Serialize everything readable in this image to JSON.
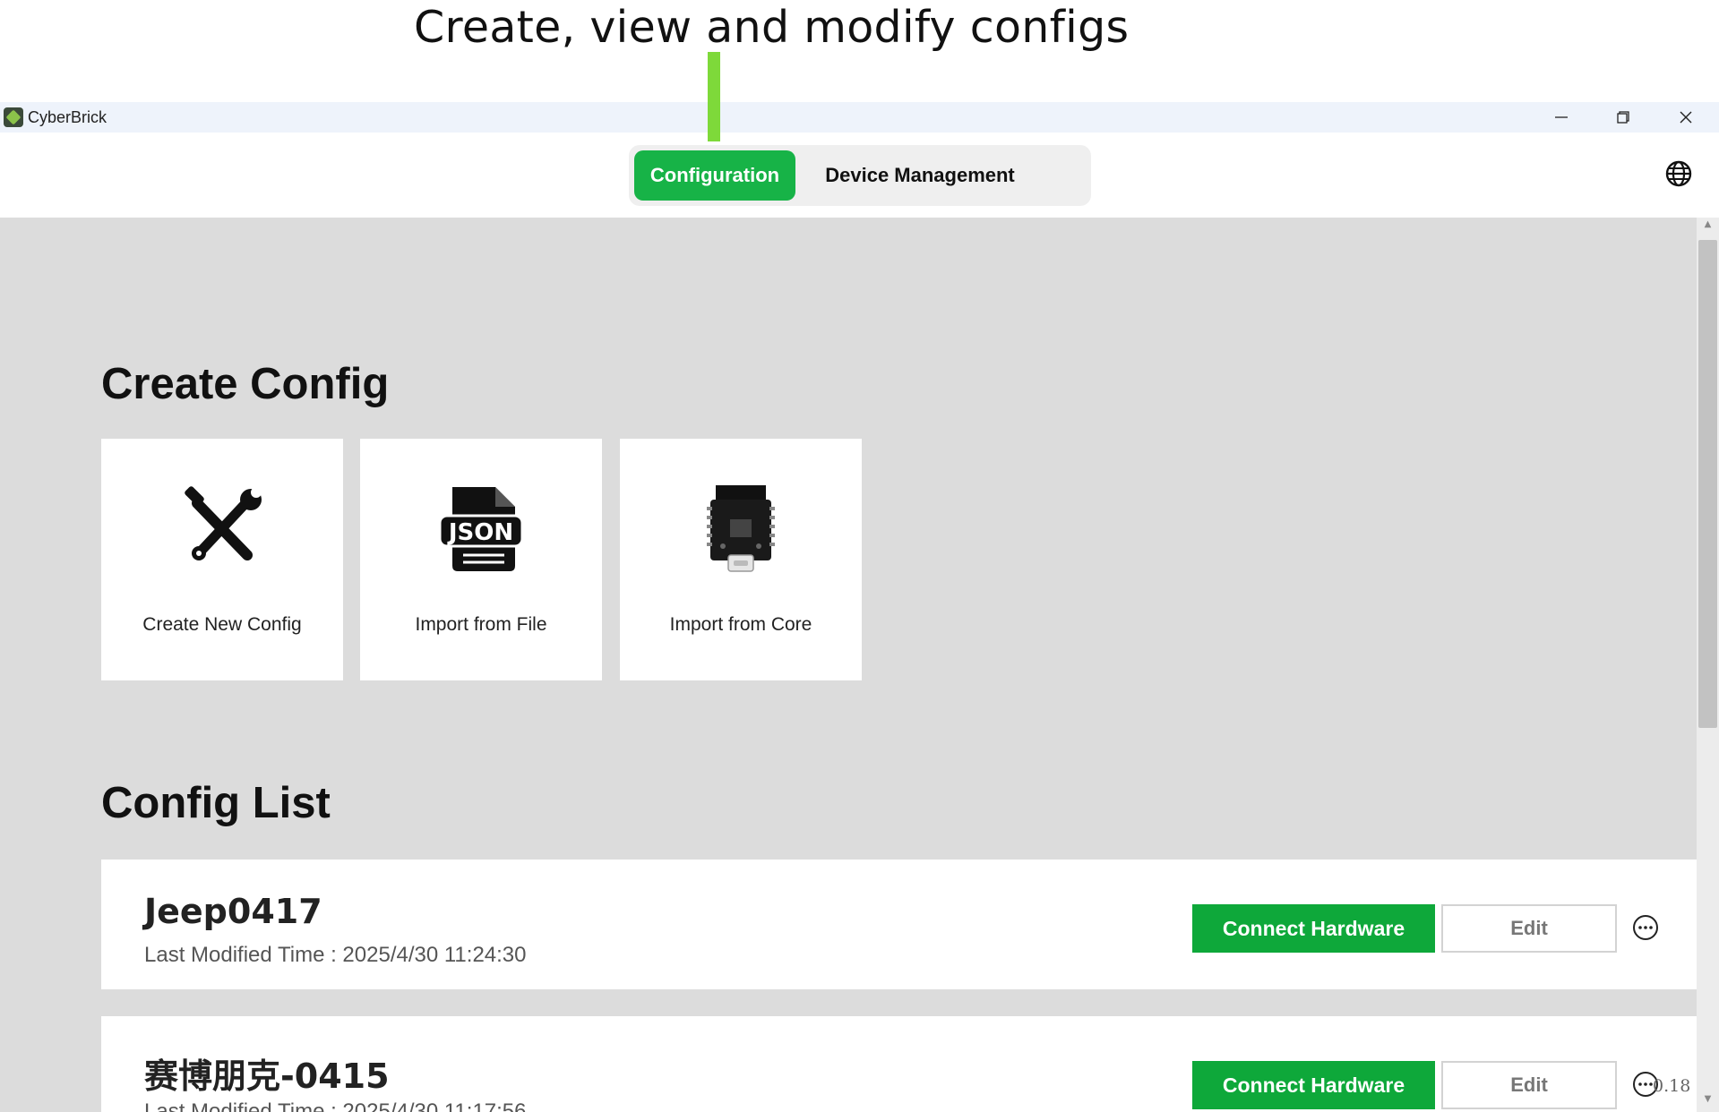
{
  "annotation": {
    "text": "Create, view and modify configs"
  },
  "window": {
    "title": "CyberBrick",
    "logo_icon": "cyberbrick-logo-icon",
    "controls": [
      "minimize-icon",
      "restore-icon",
      "close-icon"
    ]
  },
  "tabs": [
    {
      "label": "Configuration",
      "active": true
    },
    {
      "label": "Device Management",
      "active": false
    }
  ],
  "header": {
    "language_icon": "globe-icon"
  },
  "create_section": {
    "title": "Create Config",
    "cards": [
      {
        "label": "Create New Config",
        "icon": "tools-icon"
      },
      {
        "label": "Import from File",
        "icon": "json-file-icon"
      },
      {
        "label": "Import from Core",
        "icon": "core-board-icon"
      }
    ]
  },
  "list_section": {
    "title": "Config List",
    "items": [
      {
        "name": "Jeep0417",
        "modified": "Last Modified Time : 2025/4/30 11:24:30",
        "connect_label": "Connect Hardware",
        "edit_label": "Edit",
        "more_icon": "more-icon"
      },
      {
        "name": "赛博朋克-0415",
        "modified": "Last Modified Time : 2025/4/30 11:17:56",
        "connect_label": "Connect Hardware",
        "edit_label": "Edit",
        "more_icon": "more-icon"
      }
    ]
  },
  "version": "0.18",
  "colors": {
    "accent": "#17b347",
    "button_green": "#0ea83a",
    "titlebar": "#eef3fb",
    "content_bg": "#dcdcdc",
    "annotation_line": "#7ed93a"
  }
}
